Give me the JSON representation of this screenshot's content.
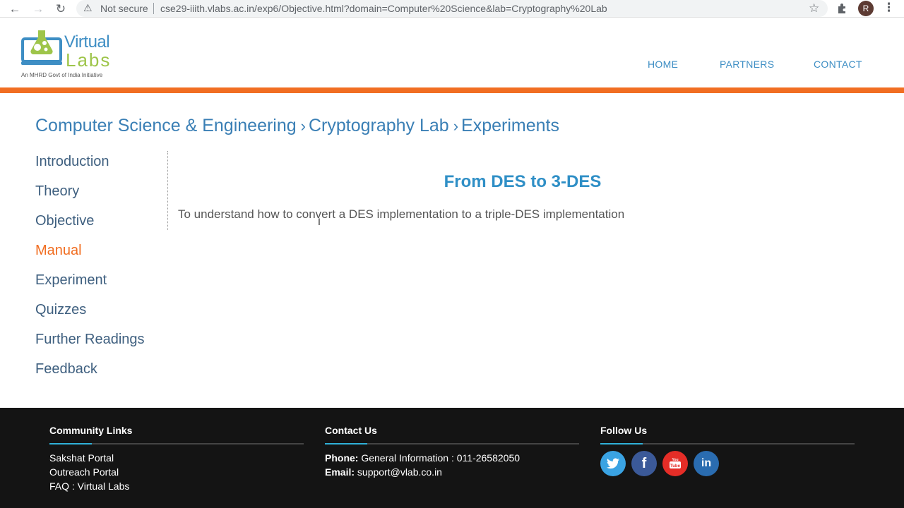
{
  "browser": {
    "security_label": "Not secure",
    "url": "cse29-iiith.vlabs.ac.in/exp6/Objective.html?domain=Computer%20Science&lab=Cryptography%20Lab",
    "profile_initial": "R"
  },
  "header": {
    "logo_word1": "Virtual",
    "logo_word2": "Labs",
    "logo_tagline": "An MHRD Govt of India Initiative",
    "nav": [
      "HOME",
      "PARTNERS",
      "CONTACT"
    ]
  },
  "breadcrumb": [
    "Computer Science & Engineering",
    "Cryptography Lab",
    "Experiments"
  ],
  "sidebar": {
    "items": [
      {
        "label": "Introduction"
      },
      {
        "label": "Theory"
      },
      {
        "label": "Objective"
      },
      {
        "label": "Manual"
      },
      {
        "label": "Experiment"
      },
      {
        "label": "Quizzes"
      },
      {
        "label": "Further Readings"
      },
      {
        "label": "Feedback"
      }
    ],
    "active_index": 3
  },
  "content": {
    "title": "From DES to 3-DES",
    "text": "To understand how to convert a DES implementation to a triple-DES implementation"
  },
  "footer": {
    "community": {
      "heading": "Community Links",
      "links": [
        "Sakshat Portal",
        "Outreach Portal",
        "FAQ : Virtual Labs"
      ]
    },
    "contact": {
      "heading": "Contact Us",
      "phone_label": "Phone:",
      "phone_value": "General Information : 011-26582050",
      "email_label": "Email:",
      "email_value": "support@vlab.co.in"
    },
    "follow": {
      "heading": "Follow Us",
      "icons": [
        {
          "name": "twitter-icon",
          "color": "#3aa3e3"
        },
        {
          "name": "facebook-icon",
          "color": "#3b5998"
        },
        {
          "name": "youtube-icon",
          "color": "#e52d27"
        },
        {
          "name": "linkedin-icon",
          "color": "#2a6cb0"
        }
      ]
    }
  },
  "colors": {
    "accent_orange": "#f16e22",
    "link_blue": "#3a7fb5",
    "footer_bg": "#141414"
  }
}
